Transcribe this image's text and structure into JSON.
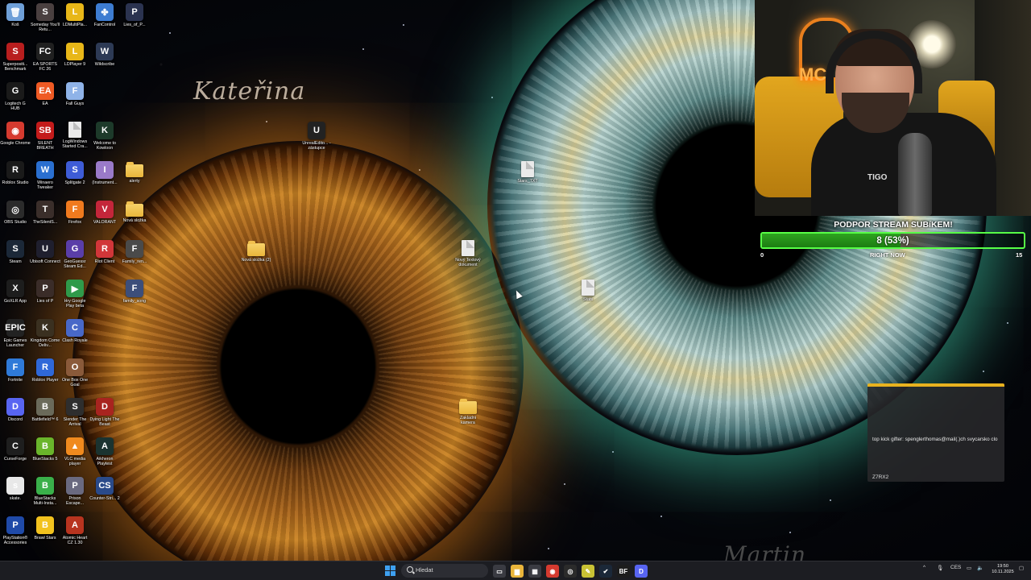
{
  "wallpaper": {
    "name_top": "Kateřina",
    "name_bottom": "Martin"
  },
  "desktop_icons": [
    {
      "label": "Koš",
      "name": "recycle-bin-icon",
      "color": "#6fa0d8",
      "glyph": "🗑"
    },
    {
      "label": "Someday You'll Retu...",
      "name": "someday-youll-return-icon",
      "color": "#4a4040",
      "glyph": "S"
    },
    {
      "label": "LDMultiPla...",
      "name": "ldmultiplayer-icon",
      "color": "#e8b718",
      "glyph": "L"
    },
    {
      "label": "FanControl",
      "name": "fancontrol-icon",
      "color": "#3d7cd1",
      "glyph": "✤"
    },
    {
      "label": "Lies_of_P...",
      "name": "lies-of-p-shortcut-icon",
      "color": "#2b3350",
      "glyph": "P"
    },
    {
      "label": "Superpositi... Benchmark",
      "name": "superposition-icon",
      "color": "#b81e1e",
      "glyph": "S"
    },
    {
      "label": "EA SPORTS FC 26",
      "name": "ea-sports-fc-icon",
      "color": "#202020",
      "glyph": "FC"
    },
    {
      "label": "LDPlayer 9",
      "name": "ldplayer-icon",
      "color": "#e8b718",
      "glyph": "L"
    },
    {
      "label": "Wildscribe",
      "name": "wildscribe-icon",
      "color": "#2d3a55",
      "glyph": "W"
    },
    {
      "label": "Logitech G HUB",
      "name": "logitech-ghub-icon",
      "color": "#1a1a1a",
      "glyph": "G"
    },
    {
      "label": "EA",
      "name": "ea-icon",
      "color": "#ef5a24",
      "glyph": "EA"
    },
    {
      "label": "Fall Guys",
      "name": "fall-guys-icon",
      "color": "#8fb3e8",
      "glyph": "F"
    },
    {
      "label": "Google Chrome",
      "name": "google-chrome-icon",
      "color": "#d53a2f",
      "glyph": "◉"
    },
    {
      "label": "SILENT BREATH",
      "name": "silent-breath-icon",
      "color": "#c41b1b",
      "glyph": "SB"
    },
    {
      "label": "LogWindows Started Cra...",
      "name": "log-file-icon",
      "color": "#f0f0f0",
      "glyph": ""
    },
    {
      "label": "Welcome to Kowloon",
      "name": "welcome-to-kowloon-icon",
      "color": "#1d3a2a",
      "glyph": "K"
    },
    {
      "label": "Roblox Studio",
      "name": "roblox-studio-icon",
      "color": "#1a1a1a",
      "glyph": "R"
    },
    {
      "label": "Winaero Tweaker",
      "name": "winaero-tweaker-icon",
      "color": "#2a6fd0",
      "glyph": "W"
    },
    {
      "label": "Splitgate 2",
      "name": "splitgate-icon",
      "color": "#3e5cd6",
      "glyph": "S"
    },
    {
      "label": "(Instrument...",
      "name": "instrument-icon",
      "color": "#9a7ac8",
      "glyph": "I"
    },
    {
      "label": "alerty",
      "name": "alerty-folder-icon",
      "color": "#3fae2e",
      "glyph": ""
    },
    {
      "label": "OBS Studio",
      "name": "obs-studio-icon",
      "color": "#2b2b2b",
      "glyph": "◎"
    },
    {
      "label": "TheSilentS...",
      "name": "the-silent-s-icon",
      "color": "#3a2e2a",
      "glyph": "T"
    },
    {
      "label": "Firefox",
      "name": "firefox-icon",
      "color": "#f07a1e",
      "glyph": "F"
    },
    {
      "label": "VALORANT",
      "name": "valorant-icon",
      "color": "#c4263a",
      "glyph": "V"
    },
    {
      "label": "Nová složka",
      "name": "new-folder-icon",
      "color": "#e9b53b",
      "glyph": ""
    },
    {
      "label": "Steam",
      "name": "steam-icon",
      "color": "#1b2838",
      "glyph": "S"
    },
    {
      "label": "Ubisoft Connect",
      "name": "ubisoft-connect-icon",
      "color": "#1f1f2e",
      "glyph": "U"
    },
    {
      "label": "GeoGuessr Steam Ed...",
      "name": "geoguessr-icon",
      "color": "#5a3ea8",
      "glyph": "G"
    },
    {
      "label": "Riot Client",
      "name": "riot-client-icon",
      "color": "#d13639",
      "glyph": "R"
    },
    {
      "label": "Family_ren...",
      "name": "family-ren-icon",
      "color": "#4a4a4a",
      "glyph": "F"
    },
    {
      "label": "GoXLR App",
      "name": "goxlr-icon",
      "color": "#1d1d1d",
      "glyph": "X"
    },
    {
      "label": "Lies of P",
      "name": "lies-of-p-icon",
      "color": "#3a2c28",
      "glyph": "P"
    },
    {
      "label": "Hry Google Play beta",
      "name": "google-play-games-icon",
      "color": "#2f9a4a",
      "glyph": "▶"
    },
    {
      "label": "family_song",
      "name": "family-song-icon",
      "color": "#3c4e7a",
      "glyph": "F"
    },
    {
      "label": "Epic Games Launcher",
      "name": "epic-games-icon",
      "color": "#222",
      "glyph": "EPIC"
    },
    {
      "label": "Kingdom Come Deliv...",
      "name": "kingdom-come-icon",
      "color": "#3a3020",
      "glyph": "K"
    },
    {
      "label": "Clash Royale",
      "name": "clash-royale-icon",
      "color": "#4868c8",
      "glyph": "C"
    },
    {
      "label": "Fortnite",
      "name": "fortnite-icon",
      "color": "#2f7ad8",
      "glyph": "F"
    },
    {
      "label": "Roblox Player",
      "name": "roblox-player-icon",
      "color": "#2f68d8",
      "glyph": "R"
    },
    {
      "label": "One Box One Goal",
      "name": "one-box-one-goal-icon",
      "color": "#8a5a3a",
      "glyph": "O"
    },
    {
      "label": "Discord",
      "name": "discord-icon",
      "color": "#5865f2",
      "glyph": "D"
    },
    {
      "label": "Battlefield™ 6",
      "name": "battlefield-6-icon",
      "color": "#6a6a5a",
      "glyph": "B"
    },
    {
      "label": "Slender The Arrival",
      "name": "slender-icon",
      "color": "#2e2e2e",
      "glyph": "S"
    },
    {
      "label": "Dying Light The Beast",
      "name": "dying-light-icon",
      "color": "#a8241f",
      "glyph": "D"
    },
    {
      "label": "CurseForge",
      "name": "curseforge-icon",
      "color": "#1e1e1e",
      "glyph": "C"
    },
    {
      "label": "BlueStacks 5",
      "name": "bluestacks-icon",
      "color": "#6ab52b",
      "glyph": "B"
    },
    {
      "label": "VLC media player",
      "name": "vlc-icon",
      "color": "#f08a1e",
      "glyph": "▲"
    },
    {
      "label": "Aikheron Playtest",
      "name": "aikheron-icon",
      "color": "#1b3330",
      "glyph": "A"
    },
    {
      "label": "skate.",
      "name": "skate-icon",
      "color": "#e8e8e8",
      "glyph": "s"
    },
    {
      "label": "BlueStacks Multi-Insta...",
      "name": "bluestacks-multi-icon",
      "color": "#3ab04a",
      "glyph": "B"
    },
    {
      "label": "Prison Escape...",
      "name": "prison-escape-icon",
      "color": "#6a6a80",
      "glyph": "P"
    },
    {
      "label": "Counter-Stri... 2",
      "name": "counter-strike-icon",
      "color": "#2a4a8a",
      "glyph": "CS"
    },
    {
      "label": "PlayStation® Accessories",
      "name": "playstation-accessories-icon",
      "color": "#1f4aa8",
      "glyph": "P"
    },
    {
      "label": "Brawl Stars",
      "name": "brawl-stars-icon",
      "color": "#f2c21e",
      "glyph": "B"
    },
    {
      "label": "Atomic Heart CZ 1.30",
      "name": "atomic-heart-icon",
      "color": "#b8341f",
      "glyph": "A"
    },
    {
      "label": "UnrealEdito... - zástupce",
      "name": "unreal-editor-icon",
      "color": "#222",
      "glyph": "U"
    },
    {
      "label": "Nová složka (2)",
      "name": "new-folder-2-icon",
      "color": "#e9b53b",
      "glyph": ""
    },
    {
      "label": "Nový Textový dokument",
      "name": "new-text-document-icon",
      "color": "#eaeaea",
      "glyph": ""
    },
    {
      "label": "Stars_TXT",
      "name": "stars-txt-icon",
      "color": "#eaeaea",
      "glyph": ""
    },
    {
      "label": "Zakladni kamera",
      "name": "zakladni-kamera-folder-icon",
      "color": "#e9b53b",
      "glyph": ""
    },
    {
      "label": "Stats",
      "name": "stats-file-icon",
      "color": "#eaeaea",
      "glyph": ""
    }
  ],
  "webcam": {
    "neon_text": "MC",
    "shirt_logo": "TIGO"
  },
  "sub_goal": {
    "title": "PODPOR STREAM SUBíKEM!",
    "value_text": "8 (53%)",
    "progress": 0.53,
    "min": "0",
    "max": "15",
    "subtitle": "RIGHT NOW"
  },
  "gifter_panel": {
    "text": "top kick gifter: spenglerthomas@mail(.)ch svycarsko clo",
    "code": "Z7RX2"
  },
  "taskbar": {
    "search_placeholder": "Hledat",
    "apps": [
      {
        "name": "task-view-icon",
        "color": "#3a3b42",
        "glyph": "▭"
      },
      {
        "name": "file-explorer-icon",
        "color": "#e9b53b",
        "glyph": "▆"
      },
      {
        "name": "microsoft-store-icon",
        "color": "#3a3b42",
        "glyph": "▦"
      },
      {
        "name": "chrome-taskbar-icon",
        "color": "#d53a2f",
        "glyph": "◉"
      },
      {
        "name": "obs-taskbar-icon",
        "color": "#2b2b2b",
        "glyph": "◎"
      },
      {
        "name": "notepad-taskbar-icon",
        "color": "#c9c234",
        "glyph": "✎"
      },
      {
        "name": "steam-taskbar-icon",
        "color": "#1b2838",
        "glyph": "✔"
      },
      {
        "name": "battlefield-taskbar-icon",
        "color": "#1d1d1d",
        "glyph": "BF"
      },
      {
        "name": "discord-taskbar-icon",
        "color": "#5865f2",
        "glyph": "D"
      }
    ],
    "language": "CES",
    "time": "19:50",
    "date": "10.11.2025"
  }
}
